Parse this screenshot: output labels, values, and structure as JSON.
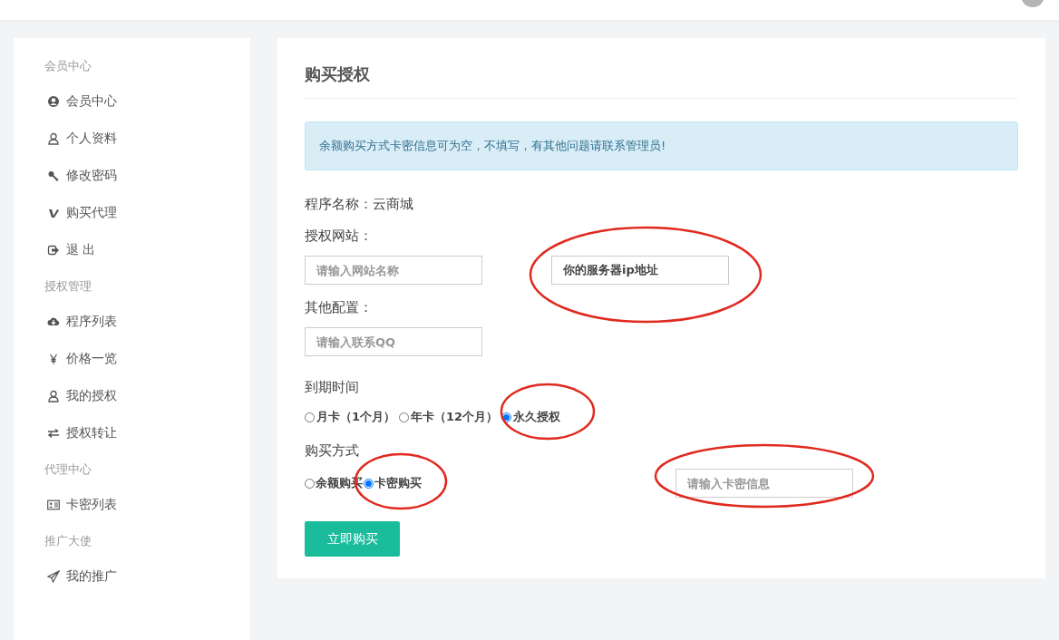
{
  "sidebar": {
    "groups": [
      {
        "title": "会员中心",
        "items": [
          {
            "kind": "account",
            "label": "会员中心"
          },
          {
            "kind": "person",
            "label": "个人资料"
          },
          {
            "kind": "key",
            "label": "修改密码"
          },
          {
            "kind": "vee",
            "label": "购买代理"
          },
          {
            "kind": "logout",
            "label": "退 出"
          }
        ]
      },
      {
        "title": "授权管理",
        "items": [
          {
            "kind": "cloud",
            "label": "程序列表"
          },
          {
            "kind": "yen",
            "label": "价格一览"
          },
          {
            "kind": "person",
            "label": "我的授权"
          },
          {
            "kind": "transfer",
            "label": "授权转让"
          }
        ]
      },
      {
        "title": "代理中心",
        "items": [
          {
            "kind": "card",
            "label": "卡密列表"
          }
        ]
      },
      {
        "title": "推广大使",
        "items": [
          {
            "kind": "plane",
            "label": "我的推广"
          }
        ]
      }
    ]
  },
  "main": {
    "title": "购买授权",
    "alert": "余额购买方式卡密信息可为空，不填写，有其他问题请联系管理员!",
    "program": "程序名称：云商城",
    "site_label": "授权网站：",
    "site_field": {
      "placeholder": "请输入网站名称"
    },
    "ip_field": {
      "value": "你的服务器ip地址"
    },
    "other_label": "其他配置：",
    "qq_field": {
      "placeholder": "请输入联系QQ"
    },
    "expiry": {
      "label": "到期时间",
      "options": [
        {
          "label": "月卡（1个月）",
          "selected": false
        },
        {
          "label": "年卡（12个月）",
          "selected": false
        },
        {
          "label": "永久授权",
          "selected": true
        }
      ]
    },
    "payment": {
      "label": "购买方式",
      "options": [
        {
          "label": "余额购买",
          "selected": false
        },
        {
          "label": "卡密购买",
          "selected": true
        }
      ],
      "card_field": {
        "placeholder": "请输入卡密信息"
      }
    },
    "button": "立即购买"
  }
}
